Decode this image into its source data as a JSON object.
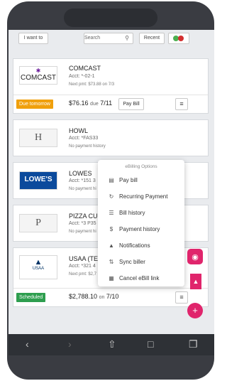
{
  "topbar": {
    "i_want_to": "I want to",
    "search_placeholder": "Search",
    "recent": "Recent"
  },
  "billers": [
    {
      "logo": "COMCAST",
      "name": "COMCAST",
      "account": "Acct: *-02-1",
      "next": "Next pmt: $73.88 on 7/3",
      "badge": "Due tomorrow",
      "badge_color": "#f0a00c",
      "amount": "$76.16",
      "due_label": "due",
      "due_date": "7/11",
      "pay_bill": "Pay Bill"
    },
    {
      "logo": "H",
      "name": "HOWL",
      "account": "Acct: *FAS33",
      "next": "No payment history"
    },
    {
      "logo": "LOWE'S",
      "name": "LOWES",
      "account": "Acct: *151 3",
      "next": "No payment hi"
    },
    {
      "logo": "P",
      "name": "PIZZA CUB",
      "account": "Acct: *3 P35",
      "next": "No payment hi"
    },
    {
      "logo": "USAA",
      "name": "USAA (TES",
      "account": "Acct: *321 4",
      "next": "Next pmt: $2,7",
      "badge": "Scheduled",
      "badge_color": "#2e9e4f",
      "amount": "$2,788.10",
      "due_label": "on",
      "due_date": "7/10"
    }
  ],
  "popup": {
    "title": "eBilling Options",
    "items": [
      {
        "label": "Pay bill",
        "icon": "bill-icon"
      },
      {
        "label": "Recurring Payment",
        "icon": "refresh-icon"
      },
      {
        "label": "Bill history",
        "icon": "list-icon"
      },
      {
        "label": "Payment history",
        "icon": "dollar-icon"
      },
      {
        "label": "Notifications",
        "icon": "bell-icon"
      },
      {
        "label": "Sync biller",
        "icon": "sync-icon"
      },
      {
        "label": "Cancel eBill link",
        "icon": "trash-icon"
      }
    ]
  },
  "menu_icon": "≡",
  "colors": {
    "fab": "#e0256c",
    "frame": "#3a3c42"
  }
}
